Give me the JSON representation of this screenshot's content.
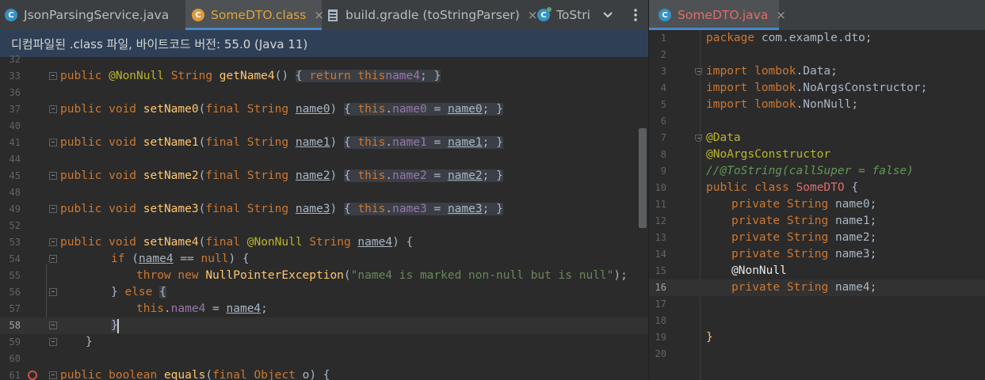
{
  "left_tabs": [
    {
      "label": "JsonParsingService.java",
      "icon": "c",
      "active": false
    },
    {
      "label": "SomeDTO.class",
      "icon": "c",
      "active": true
    },
    {
      "label": "build.gradle (toStringParser)",
      "icon": "gradle",
      "active": false
    },
    {
      "label": "ToStri",
      "icon": "c",
      "active": false
    }
  ],
  "close_glyph": "×",
  "right_tab": {
    "label": "SomeDTO.java"
  },
  "banner": "디컴파일된 .class 파일, 바이트코드 버전: 55.0 (Java 11)",
  "left_editor": {
    "current_line": "58",
    "lines": [
      {
        "n": "32"
      },
      {
        "n": "33"
      },
      {
        "n": "36"
      },
      {
        "n": "37"
      },
      {
        "n": "40"
      },
      {
        "n": "41"
      },
      {
        "n": "44"
      },
      {
        "n": "45"
      },
      {
        "n": "48"
      },
      {
        "n": "49"
      },
      {
        "n": "52"
      },
      {
        "n": "53"
      },
      {
        "n": "54"
      },
      {
        "n": "55"
      },
      {
        "n": "56"
      },
      {
        "n": "57"
      },
      {
        "n": "58"
      },
      {
        "n": "59"
      },
      {
        "n": "60"
      },
      {
        "n": "61"
      }
    ]
  },
  "right_editor": {
    "current_line": "16",
    "lines": [
      {
        "n": "1"
      },
      {
        "n": "2"
      },
      {
        "n": "3"
      },
      {
        "n": "4"
      },
      {
        "n": "5"
      },
      {
        "n": "6"
      },
      {
        "n": "7"
      },
      {
        "n": "8"
      },
      {
        "n": "9"
      },
      {
        "n": "10"
      },
      {
        "n": "11"
      },
      {
        "n": "12"
      },
      {
        "n": "13"
      },
      {
        "n": "14"
      },
      {
        "n": "15"
      },
      {
        "n": "16"
      },
      {
        "n": "17"
      },
      {
        "n": "18"
      },
      {
        "n": "19"
      },
      {
        "n": "20"
      }
    ]
  },
  "code": {
    "l33": {
      "kw1": "public ",
      "ann": "@NonNull ",
      "ty": "String ",
      "fn": "getName4",
      "rest": "() ",
      "ob": "{ ",
      "kw2": "return ",
      "kw3": "this",
      ".fld": ".",
      "fld": "name4",
      "end": "; ",
      "cb": "}"
    },
    "setters": [
      {
        "fn": "setName0",
        "pm": "name0",
        "fld": "name0"
      },
      {
        "fn": "setName1",
        "pm": "name1",
        "fld": "name1"
      },
      {
        "fn": "setName2",
        "pm": "name2",
        "fld": "name2"
      },
      {
        "fn": "setName3",
        "pm": "name3",
        "fld": "name3"
      }
    ],
    "pub": "public ",
    "void": "void ",
    "fin": "final ",
    "str": "String ",
    "this": "this",
    "l53": {
      "fn": "setName4",
      "ann": "@NonNull ",
      "pm": "name4"
    },
    "l54": {
      "kw": "if ",
      "pm": "name4",
      "op": " == ",
      "nul": "null"
    },
    "l55": {
      "kw1": "throw ",
      "kw2": "new ",
      "cls": "NullPointerException",
      "str": "\"name4 is marked non-null but is null\""
    },
    "l56": {
      "text": "} ",
      "kw": "else ",
      "brace": "{"
    },
    "l57": {
      "fld": "name4",
      "pm": "name4"
    },
    "l58": {
      "brace": "}"
    },
    "l59": {
      "brace": "}"
    },
    "l61": {
      "kw1": "public ",
      "kw2": "boolean ",
      "fn": "equals",
      "kw3": "final ",
      "ty": "Object ",
      "pm": "o",
      "end": ") {"
    }
  },
  "java": {
    "l1": {
      "kw": "package ",
      "pkg": "com.example",
      "rest": ".dto;"
    },
    "imports": [
      {
        "pkg": "lombok",
        "cls": ".Data;"
      },
      {
        "pkg": "lombok",
        "cls": ".NoArgsConstructor;"
      },
      {
        "pkg": "lombok",
        "cls": ".NonNull;"
      }
    ],
    "imp": "import ",
    "a1": "@Data",
    "a2": "@NoArgsConstructor",
    "cmt": "//@ToString(callSuper = false)",
    "cls": {
      "kw": "public class ",
      "name": "SomeDTO",
      "brace": " {"
    },
    "fields": [
      "name0;",
      "name1;",
      "name2;",
      "name3;"
    ],
    "priv": "private ",
    "str": "String ",
    "nonnull": "@NonNull",
    "f4": "name4;",
    "close": "}"
  },
  "colors": {
    "accent": "#4a88c7",
    "banner_bg": "#2f4056",
    "editor_bg": "#2b2b2b"
  }
}
